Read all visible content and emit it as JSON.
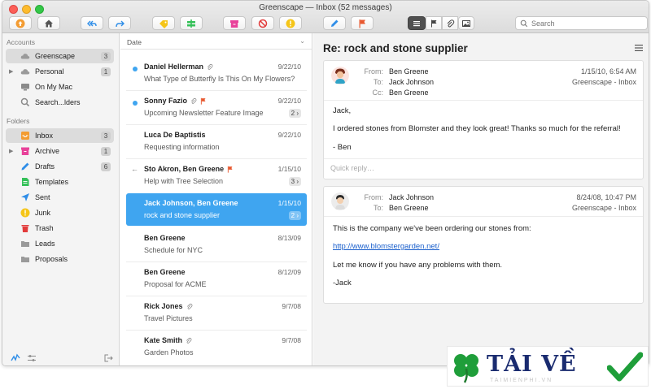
{
  "window": {
    "title": "Greenscape — Inbox (52 messages)"
  },
  "toolbar": {
    "search_placeholder": "Search",
    "buttons": [
      "upload-icon",
      "home-icon",
      "reply-all-icon",
      "forward-icon",
      "tag-icon",
      "move-icon",
      "archive-icon",
      "block-icon",
      "junk-icon",
      "compose-icon",
      "flag-icon",
      "list-view-icon",
      "flag-filter-icon",
      "attachment-filter-icon",
      "image-filter-icon"
    ]
  },
  "sidebar": {
    "accounts_header": "Accounts",
    "accounts": [
      {
        "label": "Greenscape",
        "badge": "3",
        "icon": "cloud-icon",
        "selected": true
      },
      {
        "label": "Personal",
        "badge": "1",
        "icon": "cloud-icon",
        "disclose": true
      },
      {
        "label": "On My Mac",
        "icon": "monitor-icon"
      },
      {
        "label": "Search...lders",
        "icon": "search-icon"
      }
    ],
    "folders_header": "Folders",
    "folders": [
      {
        "label": "Inbox",
        "badge": "3",
        "icon": "inbox-icon",
        "color": "#f39c32",
        "selected": true
      },
      {
        "label": "Archive",
        "badge": "1",
        "icon": "archive-icon",
        "color": "#e8429a",
        "disclose": true
      },
      {
        "label": "Drafts",
        "badge": "6",
        "icon": "pencil-icon",
        "color": "#2f8ee8"
      },
      {
        "label": "Templates",
        "icon": "template-icon",
        "color": "#34c058"
      },
      {
        "label": "Sent",
        "icon": "send-icon",
        "color": "#2f8ee8"
      },
      {
        "label": "Junk",
        "icon": "junk-icon",
        "color": "#f5c518"
      },
      {
        "label": "Trash",
        "icon": "trash-icon",
        "color": "#e23b3b"
      },
      {
        "label": "Leads",
        "icon": "folder-icon",
        "color": "#9a9a9a"
      },
      {
        "label": "Proposals",
        "icon": "folder-icon",
        "color": "#9a9a9a"
      }
    ]
  },
  "list": {
    "sort_label": "Date",
    "messages": [
      {
        "from": "Daniel Hellerman",
        "subject": "What Type of Butterfly Is This On My Flowers?",
        "date": "9/22/10",
        "unread": true,
        "attachment": true
      },
      {
        "from": "Sonny Fazio",
        "subject": "Upcoming Newsletter Feature Image",
        "date": "9/22/10",
        "unread": true,
        "attachment": true,
        "flag": true,
        "thread": "2"
      },
      {
        "from": "Luca De Baptistis",
        "subject": "Requesting information",
        "date": "9/22/10"
      },
      {
        "from": "Sto Akron, Ben Greene",
        "subject": "Help with Tree Selection",
        "date": "1/15/10",
        "replied": true,
        "flag": true,
        "thread": "3"
      },
      {
        "from": "Jack Johnson, Ben Greene",
        "subject": "rock and stone supplier",
        "date": "1/15/10",
        "selected": true,
        "thread": "2"
      },
      {
        "from": "Ben Greene",
        "subject": "Schedule for NYC",
        "date": "8/13/09"
      },
      {
        "from": "Ben Greene",
        "subject": "Proposal for ACME",
        "date": "8/12/09"
      },
      {
        "from": "Rick Jones",
        "subject": "Travel Pictures",
        "date": "9/7/08",
        "attachment": true
      },
      {
        "from": "Kate Smith",
        "subject": "Garden Photos",
        "date": "9/7/08",
        "attachment": true
      }
    ]
  },
  "reader": {
    "subject": "Re: rock and stone supplier",
    "emails": [
      {
        "from_label": "From:",
        "from": "Ben Greene",
        "to_label": "To:",
        "to": "Jack Johnson",
        "cc_label": "Cc:",
        "cc": "Ben Greene",
        "date": "1/15/10, 6:54 AM",
        "mailbox": "Greenscape - Inbox",
        "body": [
          "Jack,",
          "I ordered stones from Blomster and they look great!  Thanks so much for the referral!",
          "- Ben"
        ],
        "quick_reply": "Quick reply…"
      },
      {
        "from_label": "From:",
        "from": "Jack Johnson",
        "to_label": "To:",
        "to": "Ben Greene",
        "date": "8/24/08, 10:47 PM",
        "mailbox": "Greenscape - Inbox",
        "body": [
          "This is the company we've been ordering our stones from:",
          "http://www.blomstergarden.net/",
          "Let me know if you have any problems with them.",
          "-Jack"
        ]
      }
    ]
  },
  "watermark": {
    "text": "TẢI VỀ",
    "sub": "TAIMIENPHI.VN"
  }
}
